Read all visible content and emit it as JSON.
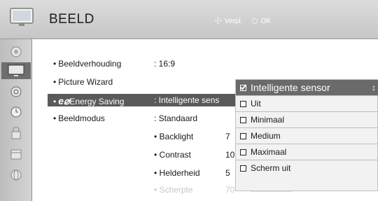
{
  "header": {
    "title": "BEELD",
    "hint_nav": "Verpl.",
    "hint_ok": "OK"
  },
  "sidebar": {
    "items": [
      {
        "icon": "picture-icon"
      },
      {
        "icon": "tv-icon",
        "active": true
      },
      {
        "icon": "audio-icon"
      },
      {
        "icon": "clock-icon"
      },
      {
        "icon": "lock-icon"
      },
      {
        "icon": "calendar-icon"
      },
      {
        "icon": "globe-icon"
      }
    ]
  },
  "menu": {
    "rows": [
      {
        "label": "Beeldverhouding",
        "value": ": 16:9"
      },
      {
        "label": "Picture Wizard",
        "value": ""
      },
      {
        "logo": "e⌀",
        "label": "Energy Saving",
        "value": ": Intelligente sens"
      },
      {
        "label": "Beeldmodus",
        "value": ": Standaard"
      }
    ],
    "sub_rows": [
      {
        "label": "• Backlight",
        "value": "7"
      },
      {
        "label": "• Contrast",
        "value": "10"
      },
      {
        "label": "• Helderheid",
        "value": "5"
      },
      {
        "label": "• Scherpte",
        "value": "70"
      }
    ],
    "bullet": "•"
  },
  "dropdown": {
    "selected": "Intelligente sensor",
    "options": [
      "Uit",
      "Minimaal",
      "Medium",
      "Maximaal",
      "Scherm uit"
    ]
  },
  "colors": {
    "header_bg": "#d0d0d0",
    "highlight": "#5a5a5a",
    "dropdown_bg": "#f2f2f2"
  }
}
